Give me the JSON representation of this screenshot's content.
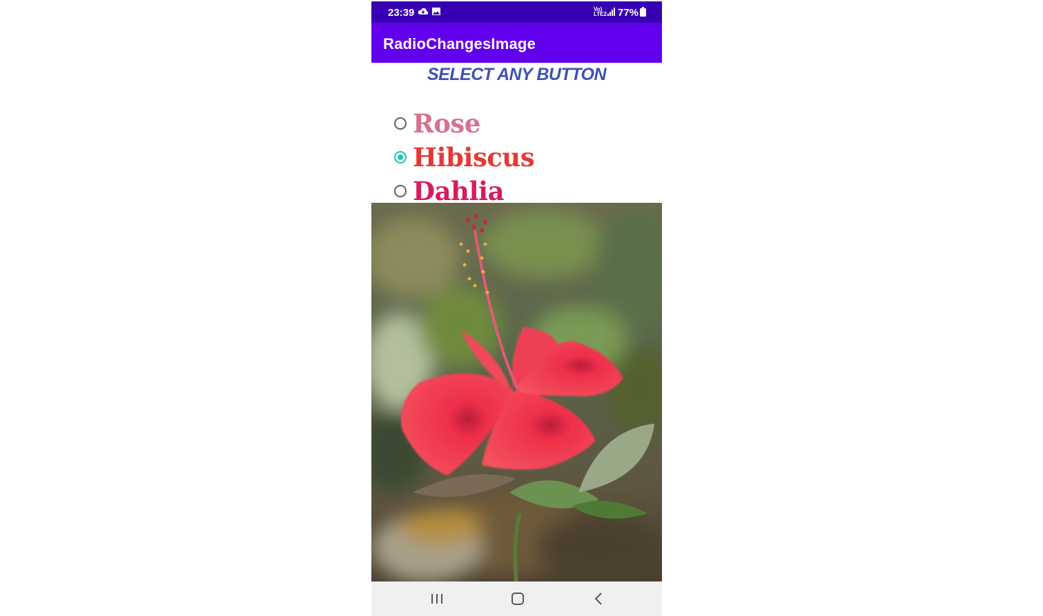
{
  "status_bar": {
    "time": "23:39",
    "network_top": "Vo)",
    "network_bottom": "LTE2",
    "battery": "77%",
    "icons": [
      "cloud-icon",
      "image-icon",
      "signal-icon",
      "battery-icon"
    ]
  },
  "app_bar": {
    "title": "RadioChangesImage",
    "color": "#6200ee"
  },
  "main": {
    "heading": "SELECT ANY BUTTON",
    "options": [
      {
        "label": "Rose",
        "checked": false,
        "color": "#d9708f"
      },
      {
        "label": "Hibiscus",
        "checked": true,
        "color": "#e53935"
      },
      {
        "label": "Dahlia",
        "checked": false,
        "color": "#d81b60"
      }
    ],
    "image": {
      "subject": "hibiscus-flower"
    }
  },
  "nav_bar": {
    "icons": [
      "recents-icon",
      "home-icon",
      "back-icon"
    ]
  },
  "colors": {
    "status_bar": "#3700b3",
    "heading": "#3f51b5",
    "radio_accent": "#18c8b4"
  }
}
